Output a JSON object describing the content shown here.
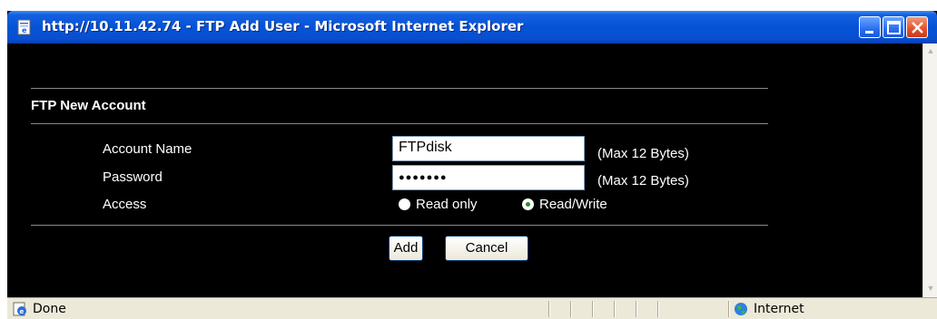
{
  "window": {
    "title": "http://10.11.42.74 - FTP Add User - Microsoft Internet Explorer"
  },
  "form": {
    "section_title": "FTP New Account",
    "account_name": {
      "label": "Account Name",
      "value": "FTPdisk",
      "hint": "(Max 12 Bytes)"
    },
    "password": {
      "label": "Password",
      "value": "●●●●●●●",
      "hint": "(Max 12 Bytes)"
    },
    "access": {
      "label": "Access",
      "options": [
        {
          "label": "Read only",
          "checked": false
        },
        {
          "label": "Read/Write",
          "checked": true
        }
      ]
    },
    "buttons": {
      "add": "Add",
      "cancel": "Cancel"
    }
  },
  "statusbar": {
    "status": "Done",
    "zone": "Internet"
  },
  "colors": {
    "titlebar": "#0453d6",
    "content_background": "#000000",
    "text": "#ffffff",
    "statusbar": "#ece9d8"
  }
}
